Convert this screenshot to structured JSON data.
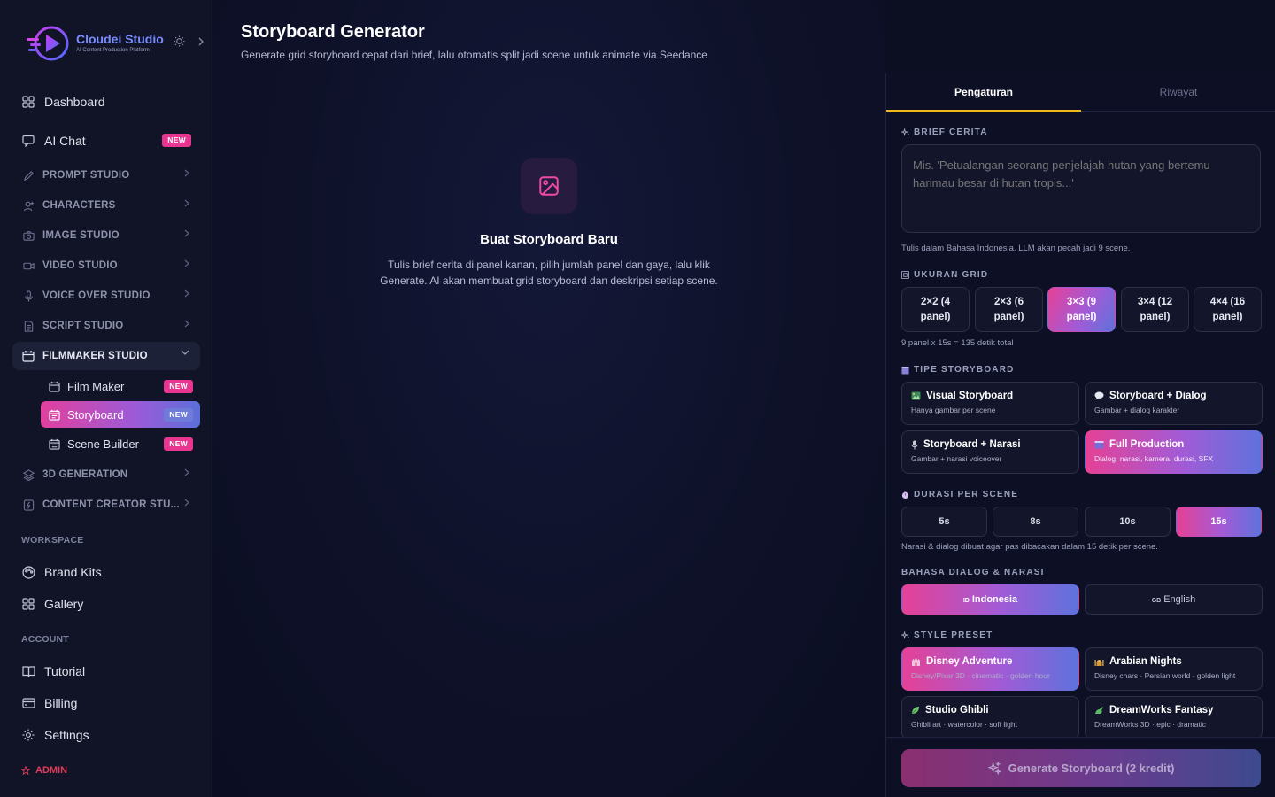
{
  "brand": {
    "title": "Cloudei Studio",
    "subtitle": "AI Content Production Platform"
  },
  "sidebar": {
    "dashboard": "Dashboard",
    "ai_chat": "AI Chat",
    "ai_chat_badge": "NEW",
    "sections": [
      {
        "label": "PROMPT STUDIO"
      },
      {
        "label": "CHARACTERS"
      },
      {
        "label": "IMAGE STUDIO"
      },
      {
        "label": "VIDEO STUDIO"
      },
      {
        "label": "VOICE OVER STUDIO"
      },
      {
        "label": "SCRIPT STUDIO"
      },
      {
        "label": "FILMMAKER STUDIO"
      },
      {
        "label": "3D GENERATION"
      },
      {
        "label": "CONTENT CREATOR STU..."
      }
    ],
    "filmmaker_items": [
      {
        "label": "Film Maker",
        "badge": "NEW"
      },
      {
        "label": "Storyboard",
        "badge": "NEW"
      },
      {
        "label": "Scene Builder",
        "badge": "NEW"
      }
    ],
    "workspace_label": "WORKSPACE",
    "workspace_items": [
      {
        "label": "Brand Kits"
      },
      {
        "label": "Gallery"
      }
    ],
    "account_label": "ACCOUNT",
    "account_items": [
      {
        "label": "Tutorial"
      },
      {
        "label": "Billing"
      },
      {
        "label": "Settings"
      }
    ],
    "admin_label": "ADMIN"
  },
  "page": {
    "title": "Storyboard Generator",
    "subtitle": "Generate grid storyboard cepat dari brief, lalu otomatis split jadi scene untuk animate via Seedance"
  },
  "empty_state": {
    "title": "Buat Storyboard Baru",
    "description": "Tulis brief cerita di panel kanan, pilih jumlah panel dan gaya, lalu klik Generate. AI akan membuat grid storyboard dan deskripsi setiap scene."
  },
  "panel": {
    "tabs": [
      {
        "label": "Pengaturan",
        "active": true
      },
      {
        "label": "Riwayat",
        "active": false
      }
    ],
    "brief": {
      "label": "BRIEF CERITA",
      "placeholder": "Mis. 'Petualangan seorang penjelajah hutan yang bertemu harimau besar di hutan tropis...'",
      "hint": "Tulis dalam Bahasa Indonesia. LLM akan pecah jadi 9 scene."
    },
    "grid": {
      "label": "UKURAN GRID",
      "options": [
        {
          "line1": "2×2 (4",
          "line2": "panel)"
        },
        {
          "line1": "2×3 (6",
          "line2": "panel)"
        },
        {
          "line1": "3×3 (9",
          "line2": "panel)"
        },
        {
          "line1": "3×4 (12",
          "line2": "panel)"
        },
        {
          "line1": "4×4 (16",
          "line2": "panel)"
        }
      ],
      "selected": 2,
      "hint": "9 panel x 15s = 135 detik total"
    },
    "type": {
      "label": "TIPE STORYBOARD",
      "options": [
        {
          "title": "Visual Storyboard",
          "sub": "Hanya gambar per scene"
        },
        {
          "title": "Storyboard + Dialog",
          "sub": "Gambar + dialog karakter"
        },
        {
          "title": "Storyboard + Narasi",
          "sub": "Gambar + narasi voiceover"
        },
        {
          "title": "Full Production",
          "sub": "Dialog, narasi, kamera, durasi, SFX"
        }
      ],
      "selected": 3
    },
    "duration": {
      "label": "DURASI PER SCENE",
      "options": [
        "5s",
        "8s",
        "10s",
        "15s"
      ],
      "selected": 3,
      "hint": "Narasi & dialog dibuat agar pas dibacakan dalam 15 detik per scene."
    },
    "language": {
      "label": "BAHASA DIALOG & NARASI",
      "options": [
        {
          "flag": "ID",
          "label": "Indonesia"
        },
        {
          "flag": "GB",
          "label": "English"
        }
      ],
      "selected": 0
    },
    "style": {
      "label": "STYLE PRESET",
      "options": [
        {
          "title": "Disney Adventure",
          "sub": "Disney/Pixar 3D · cinematic · golden hour"
        },
        {
          "title": "Arabian Nights",
          "sub": "Disney chars · Persian world · golden light"
        },
        {
          "title": "Studio Ghibli",
          "sub": "Ghibli art · watercolor · soft light"
        },
        {
          "title": "DreamWorks Fantasy",
          "sub": "DreamWorks 3D · epic · dramatic"
        }
      ],
      "selected": 0
    },
    "generate_label": "Generate Storyboard (2 kredit)"
  },
  "colors": {
    "accent_pink": "#e54196",
    "accent_blue": "#5e72dc",
    "tab_underline": "#f0b81a",
    "admin": "#e23a5a"
  }
}
